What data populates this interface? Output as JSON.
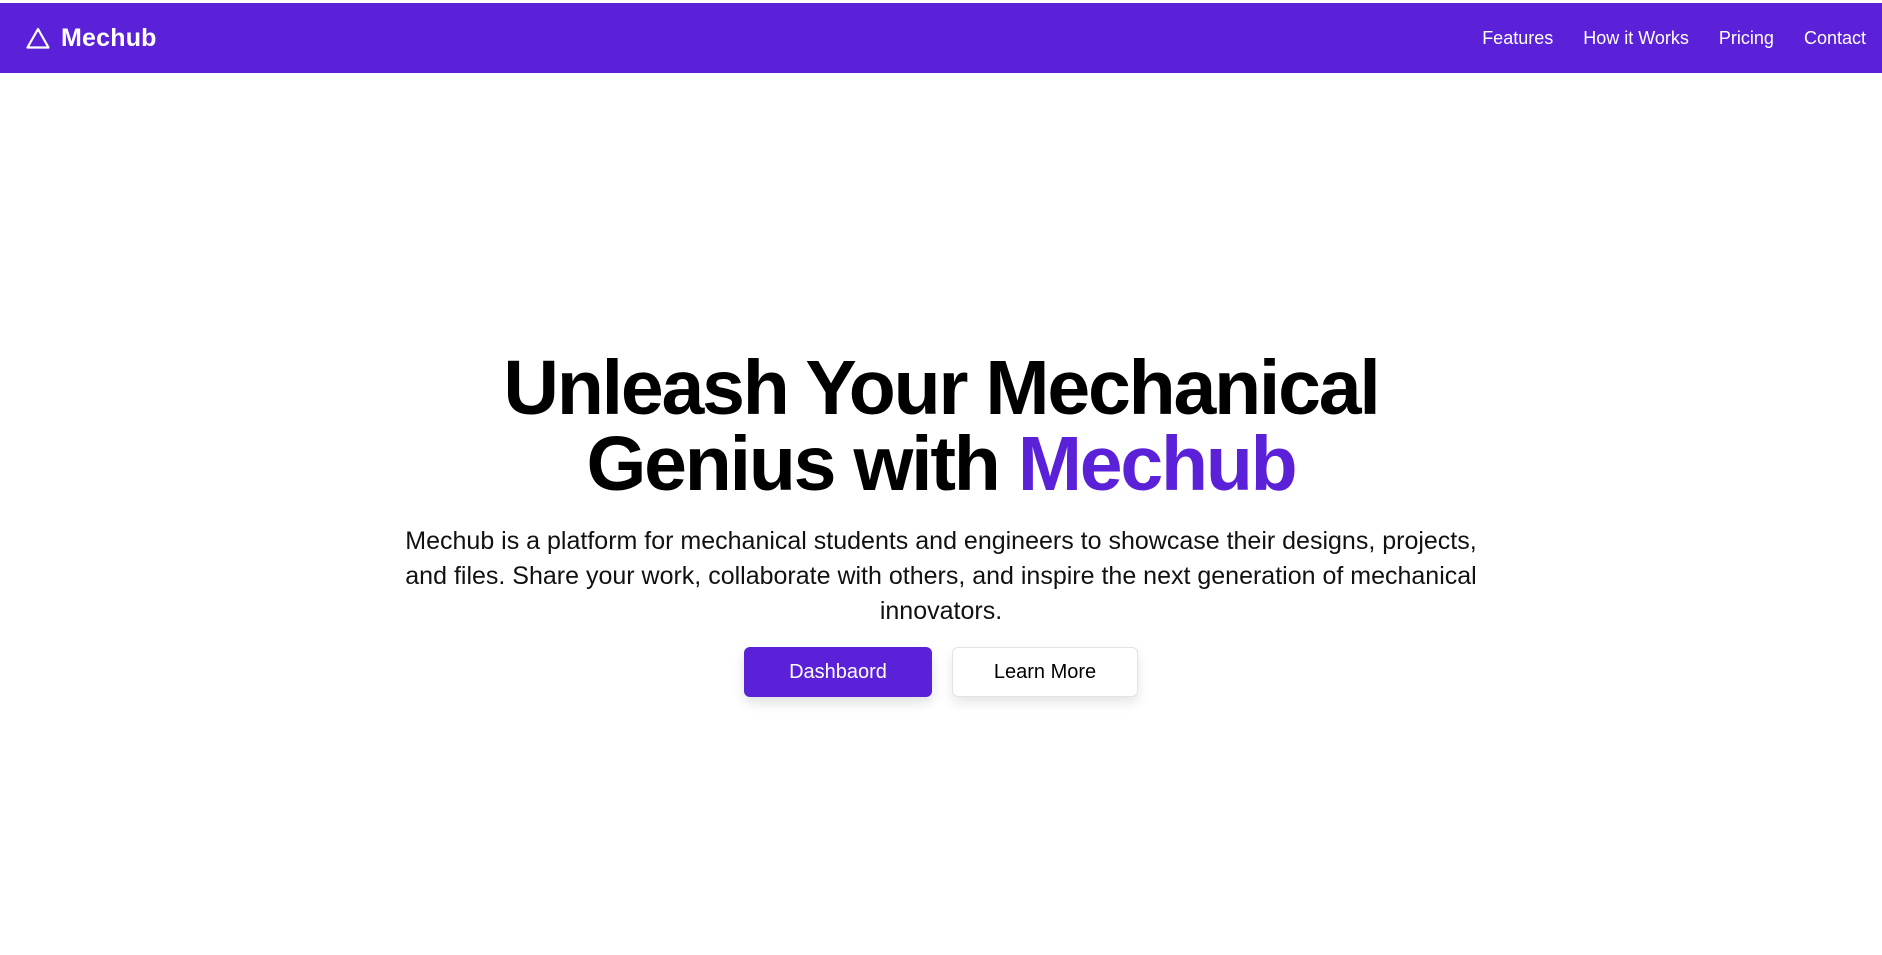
{
  "header": {
    "brand_name": "Mechub",
    "brand_icon": "triangle-icon",
    "nav": [
      {
        "label": "Features"
      },
      {
        "label": "How it Works"
      },
      {
        "label": "Pricing"
      },
      {
        "label": "Contact"
      }
    ]
  },
  "hero": {
    "title_prefix": "Unleash Your Mechanical Genius with ",
    "title_accent": "Mechub",
    "description": "Mechub is a platform for mechanical students and engineers to showcase their designs, projects, and files. Share your work, collaborate with others, and inspire the next generation of mechanical innovators.",
    "primary_button": "Dashbaord",
    "secondary_button": "Learn More"
  },
  "colors": {
    "brand": "#5b21d9",
    "background": "#ffffff",
    "text": "#000000"
  }
}
